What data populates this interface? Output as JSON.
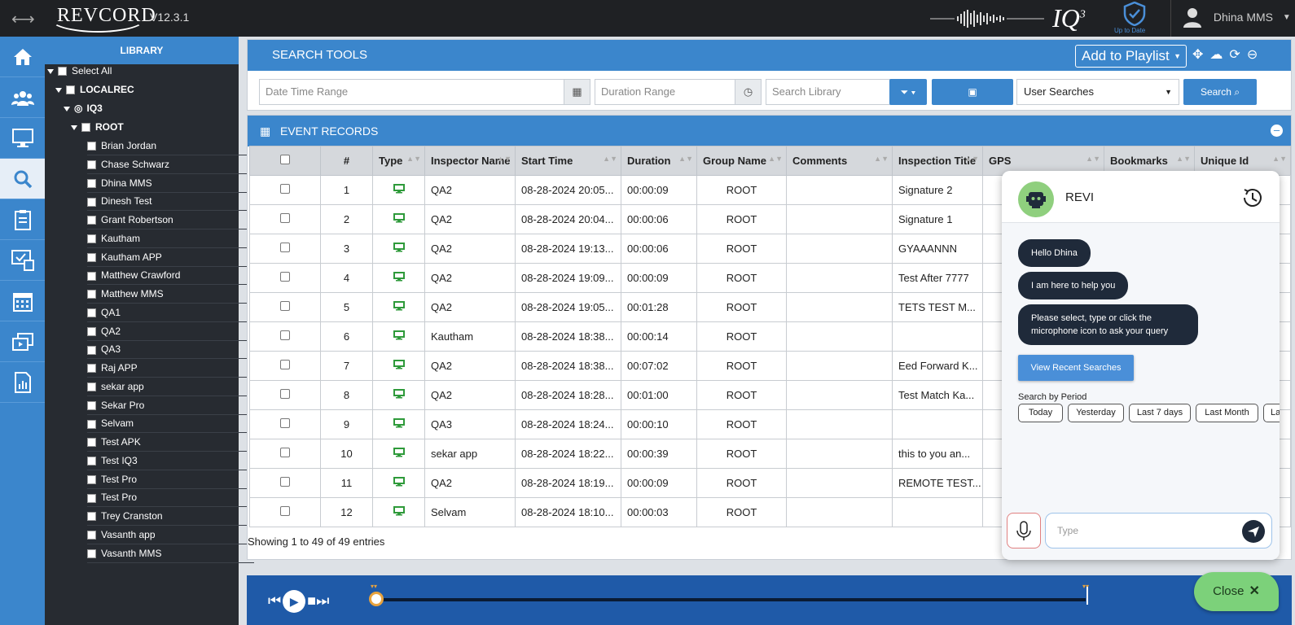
{
  "app": {
    "brand": "REVCORD",
    "version": "V12.3.1",
    "product": "IQ",
    "product_sup": "3",
    "status_label": "Up to Date",
    "user": "Dhina MMS"
  },
  "colors": {
    "accent": "#3b86cc",
    "sidebar": "#272b31",
    "topbar": "#1f2124",
    "close_button": "#7cd17a"
  },
  "nav_icons": [
    "home-icon",
    "users-icon",
    "monitor-icon",
    "search-icon",
    "clipboard-icon",
    "screen-check-icon",
    "calendar-icon",
    "media-icon",
    "report-icon"
  ],
  "library": {
    "title": "LIBRARY",
    "select_all": "Select All",
    "localrec": "LOCALREC",
    "iq3": "IQ3",
    "root": "ROOT",
    "items": [
      "Brian Jordan",
      "Chase Schwarz",
      "Dhina MMS",
      "Dinesh Test",
      "Grant Robertson",
      "Kautham",
      "Kautham APP",
      "Matthew Crawford",
      "Matthew MMS",
      "QA1",
      "QA2",
      "QA3",
      "Raj APP",
      "sekar app",
      "Sekar Pro",
      "Selvam",
      "Test APK",
      "Test IQ3",
      "Test Pro",
      "Test Pro",
      "Trey Cranston",
      "Vasanth app",
      "Vasanth MMS"
    ]
  },
  "search_tools": {
    "title": "SEARCH TOOLS",
    "add_to_playlist": "Add to Playlist",
    "date_placeholder": "Date Time Range",
    "duration_placeholder": "Duration Range",
    "library_placeholder": "Search Library",
    "user_searches": "User Searches",
    "search_btn": "Search"
  },
  "event_records": {
    "title": "EVENT RECORDS",
    "columns": [
      "#",
      "Type",
      "Inspector Name",
      "Start Time",
      "Duration",
      "Group Name",
      "Comments",
      "Inspection Title",
      "GPS",
      "Bookmarks",
      "Unique Id"
    ],
    "rows": [
      [
        "1",
        "QA2",
        "08-28-2024 20:05...",
        "00:00:09",
        "ROOT",
        "",
        "Signature 2"
      ],
      [
        "2",
        "QA2",
        "08-28-2024 20:04...",
        "00:00:06",
        "ROOT",
        "",
        "Signature 1"
      ],
      [
        "3",
        "QA2",
        "08-28-2024 19:13...",
        "00:00:06",
        "ROOT",
        "",
        "GYAAANNN"
      ],
      [
        "4",
        "QA2",
        "08-28-2024 19:09...",
        "00:00:09",
        "ROOT",
        "",
        "Test After 7777"
      ],
      [
        "5",
        "QA2",
        "08-28-2024 19:05...",
        "00:01:28",
        "ROOT",
        "",
        "TETS TEST M..."
      ],
      [
        "6",
        "Kautham",
        "08-28-2024 18:38...",
        "00:00:14",
        "ROOT",
        "",
        ""
      ],
      [
        "7",
        "QA2",
        "08-28-2024 18:38...",
        "00:07:02",
        "ROOT",
        "",
        "Eed Forward K..."
      ],
      [
        "8",
        "QA2",
        "08-28-2024 18:28...",
        "00:01:00",
        "ROOT",
        "",
        "Test Match Ka..."
      ],
      [
        "9",
        "QA3",
        "08-28-2024 18:24...",
        "00:00:10",
        "ROOT",
        "",
        ""
      ],
      [
        "10",
        "sekar app",
        "08-28-2024 18:22...",
        "00:00:39",
        "ROOT",
        "",
        "this to you an..."
      ],
      [
        "11",
        "QA2",
        "08-28-2024 18:19...",
        "00:00:09",
        "ROOT",
        "",
        "REMOTE TEST..."
      ],
      [
        "12",
        "Selvam",
        "08-28-2024 18:10...",
        "00:00:03",
        "ROOT",
        "",
        ""
      ]
    ],
    "showing": "Showing 1 to 49 of 49 entries"
  },
  "chat": {
    "name": "REVI",
    "messages": [
      "Hello Dhina",
      "I am here to help you",
      "Please select, type or click the microphone icon to ask your query"
    ],
    "recent_btn": "View Recent Searches",
    "period_label": "Search by Period",
    "periods": [
      "Today",
      "Yesterday",
      "Last 7 days",
      "Last Month",
      "La"
    ],
    "input_placeholder": "Type"
  },
  "close_label": "Close"
}
